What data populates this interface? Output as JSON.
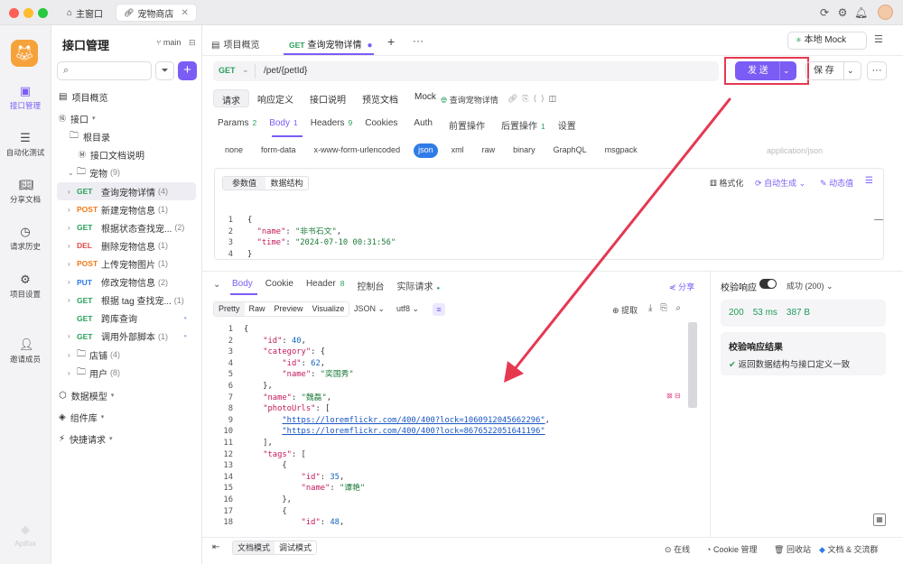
{
  "colors": {
    "accent": "#7b5cf5",
    "get": "#2aa05b",
    "post": "#f07a1a",
    "put": "#2f7be8",
    "del": "#e24b4b",
    "highlight": "#e53950"
  },
  "titlebar": {
    "tab_home": "主窗口",
    "tab_shop": "宠物商店"
  },
  "rail": {
    "api": "接口管理",
    "test": "自动化测试",
    "share": "分享文档",
    "history": "请求历史",
    "settings": "项目设置",
    "invite": "邀请成员",
    "brand": "Apifox"
  },
  "sidebar": {
    "title": "接口管理",
    "branch": "main",
    "search_placeholder": "",
    "overview": "项目概览",
    "api": "接口",
    "root": "根目录",
    "doc": "接口文档说明",
    "pet_folder": {
      "name": "宠物",
      "count": "(9)"
    },
    "items": [
      {
        "method": "GET",
        "name": "查询宠物详情",
        "count": "(4)"
      },
      {
        "method": "POST",
        "name": "新建宠物信息",
        "count": "(1)"
      },
      {
        "method": "GET",
        "name": "根据状态查找宠...",
        "count": "(2)"
      },
      {
        "method": "DEL",
        "name": "删除宠物信息",
        "count": "(1)"
      },
      {
        "method": "POST",
        "name": "上传宠物图片",
        "count": "(1)"
      },
      {
        "method": "PUT",
        "name": "修改宠物信息",
        "count": "(2)"
      },
      {
        "method": "GET",
        "name": "根据 tag 查找宠...",
        "count": "(1)"
      },
      {
        "method": "GET",
        "name": "跨库查询",
        "count": ""
      },
      {
        "method": "GET",
        "name": "调用外部脚本",
        "count": "(1)"
      }
    ],
    "store": {
      "name": "店铺",
      "count": "(4)"
    },
    "user": {
      "name": "用户",
      "count": "(8)"
    },
    "models": "数据模型",
    "components": "组件库",
    "quick": "快捷请求"
  },
  "tabs": {
    "overview": "项目概览",
    "current_method": "GET",
    "current": "查询宠物详情",
    "env": "本地 Mock"
  },
  "request": {
    "method": "GET",
    "url": "/pet/{petId}",
    "send": "发 送",
    "save": "保 存"
  },
  "subtabs": [
    "请求",
    "响应定义",
    "接口说明",
    "预览文档",
    "Mock"
  ],
  "api_name": "查询宠物详情",
  "params_tabs": [
    {
      "label": "Params",
      "count": "2"
    },
    {
      "label": "Body",
      "count": "1"
    },
    {
      "label": "Headers",
      "count": "9"
    },
    {
      "label": "Cookies",
      "count": ""
    },
    {
      "label": "Auth",
      "count": ""
    },
    {
      "label": "前置操作",
      "count": ""
    },
    {
      "label": "后置操作",
      "count": "1"
    },
    {
      "label": "设置",
      "count": ""
    }
  ],
  "body_types": [
    "none",
    "form-data",
    "x-www-form-urlencoded",
    "json",
    "xml",
    "raw",
    "binary",
    "GraphQL",
    "msgpack"
  ],
  "content_type": "application/json",
  "body_editor": {
    "tab1": "参数值",
    "tab2": "数据结构",
    "format": "格式化",
    "autogen": "自动生成",
    "dynamic": "动态值"
  },
  "response_tabs": [
    "Body",
    "Cookie",
    "Header",
    "控制台",
    "实际请求"
  ],
  "response_header_count": "8",
  "share": "分享",
  "resp_toolbar": {
    "views": [
      "Pretty",
      "Raw",
      "Preview",
      "Visualize"
    ],
    "format": "JSON",
    "encoding": "utf8",
    "extract": "提取"
  },
  "validate": {
    "label": "校验响应",
    "status": "成功 (200)",
    "code": "200",
    "time": "53 ms",
    "size": "387 B",
    "result_title": "校验响应结果",
    "result": "返回数据结构与接口定义一致"
  },
  "bottom": {
    "doc_mode": "文档模式",
    "debug_mode": "调试模式",
    "online": "在线",
    "cookie": "Cookie 管理",
    "trash": "回收站",
    "community": "文档 & 交流群"
  }
}
